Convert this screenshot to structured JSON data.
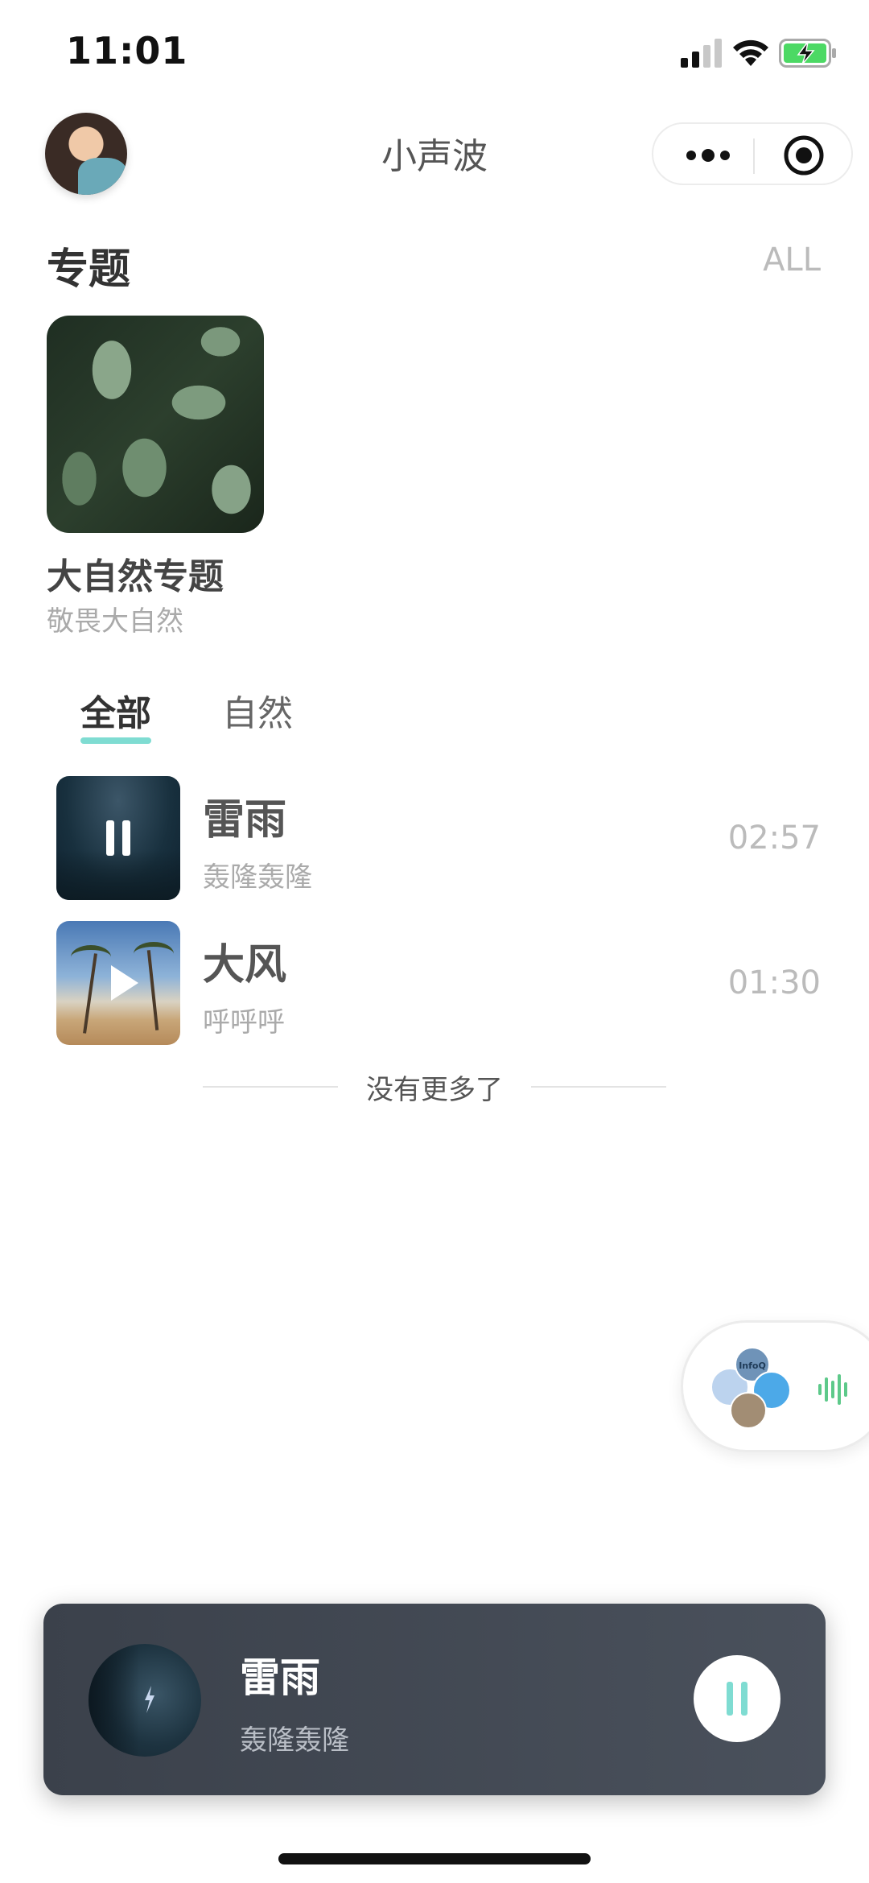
{
  "status_bar": {
    "time": "11:01"
  },
  "nav": {
    "title": "小声波"
  },
  "topics": {
    "section_title": "专题",
    "all_link": "ALL",
    "items": [
      {
        "name": "大自然专题",
        "subtitle": "敬畏大自然"
      }
    ]
  },
  "tabs": [
    {
      "label": "全部",
      "active": true
    },
    {
      "label": "自然",
      "active": false
    }
  ],
  "sounds": [
    {
      "title": "雷雨",
      "subtitle": "轰隆轰隆",
      "duration": "02:57",
      "state": "playing",
      "icon": "pause-icon"
    },
    {
      "title": "大风",
      "subtitle": "呼呼呼",
      "duration": "01:30",
      "state": "paused",
      "icon": "play-icon"
    }
  ],
  "list_end_text": "没有更多了",
  "floating_widget": {
    "badge_text": "InfoQ"
  },
  "player": {
    "title": "雷雨",
    "subtitle": "轰隆轰隆",
    "state": "playing",
    "accent_color": "#7fdcd2"
  },
  "colors": {
    "accent": "#7fdcd2",
    "player_bg": "#3b414b"
  }
}
